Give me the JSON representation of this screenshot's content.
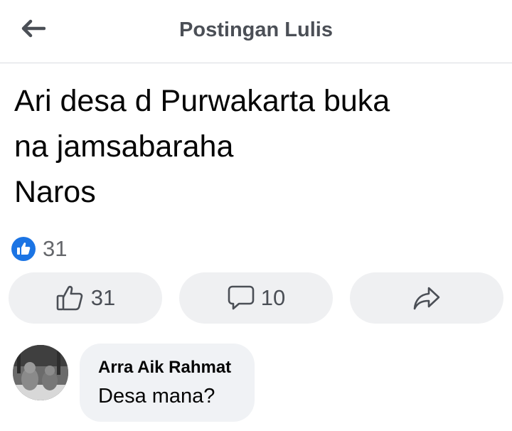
{
  "header": {
    "title": "Postingan Lulis",
    "back_icon": "arrow-left-icon"
  },
  "post": {
    "lines": [
      "Ari desa d Purwakarta buka",
      "na jamsabaraha",
      "Naros"
    ]
  },
  "reactions": {
    "icon": "like-badge-icon",
    "count": "31"
  },
  "actions": {
    "like": {
      "icon": "thumbs-up-icon",
      "count": "31"
    },
    "comment": {
      "icon": "speech-bubble-icon",
      "count": "10"
    },
    "share": {
      "icon": "share-arrow-icon"
    }
  },
  "comments": [
    {
      "author": "Arra Aik Rahmat",
      "text": "Desa mana?"
    }
  ],
  "colors": {
    "accent": "#1b74e4",
    "button_bg": "#eff0f2",
    "bubble_bg": "#f0f2f5",
    "muted_text": "#65676b"
  }
}
